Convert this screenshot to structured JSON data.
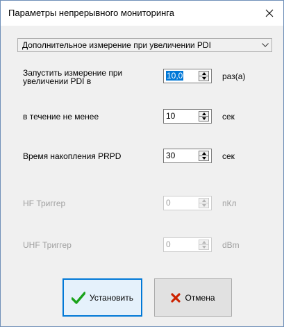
{
  "window": {
    "title": "Параметры непрерывного мониторинга"
  },
  "mode_select": {
    "selected": "Дополнительное измерение при увеличении PDI"
  },
  "fields": {
    "start_measure": {
      "label_line1": "Запустить измерение при",
      "label_line2": "увеличении PDI в",
      "value": "10,0",
      "unit": "раз(а)"
    },
    "duration": {
      "label": "в течение не менее",
      "value": "10",
      "unit": "сек"
    },
    "prpd": {
      "label": "Время накопления PRPD",
      "value": "30",
      "unit": "сек"
    },
    "hf_trigger": {
      "label": "HF Триггер",
      "value": "0",
      "unit": "пКл"
    },
    "uhf_trigger": {
      "label": "UHF Триггер",
      "value": "0",
      "unit": "dBm"
    }
  },
  "buttons": {
    "ok_label": "Установить",
    "cancel_label": "Отмена"
  },
  "colors": {
    "accent": "#0078d7",
    "check": "#1aa31a",
    "cross": "#cc2200",
    "disabled_text": "#a0a0a0"
  }
}
